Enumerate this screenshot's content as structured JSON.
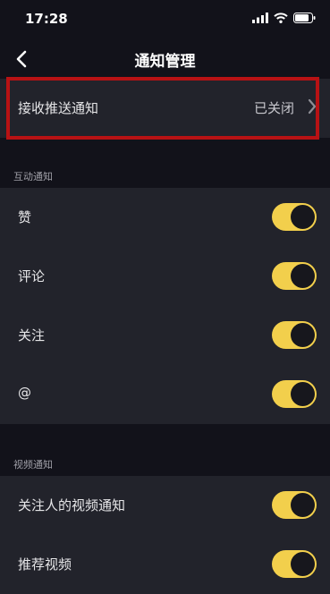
{
  "status_bar": {
    "time": "17:28",
    "icons": [
      "cellular-signal-icon",
      "wifi-icon",
      "battery-icon"
    ]
  },
  "nav": {
    "title": "通知管理",
    "back_icon": "chevron-left-icon"
  },
  "push": {
    "label": "接收推送通知",
    "status": "已关闭",
    "chevron_icon": "chevron-right-icon"
  },
  "sections": [
    {
      "header": "互动通知",
      "items": [
        {
          "label": "赞",
          "enabled": true
        },
        {
          "label": "评论",
          "enabled": true
        },
        {
          "label": "关注",
          "enabled": true
        },
        {
          "label": "@",
          "enabled": true
        }
      ]
    },
    {
      "header": "视频通知",
      "items": [
        {
          "label": "关注人的视频通知",
          "enabled": true
        },
        {
          "label": "推荐视频",
          "enabled": true
        }
      ]
    }
  ],
  "colors": {
    "background": "#12121a",
    "row_background": "#22232b",
    "toggle_on": "#f2cf4c",
    "highlight": "#b81214"
  }
}
